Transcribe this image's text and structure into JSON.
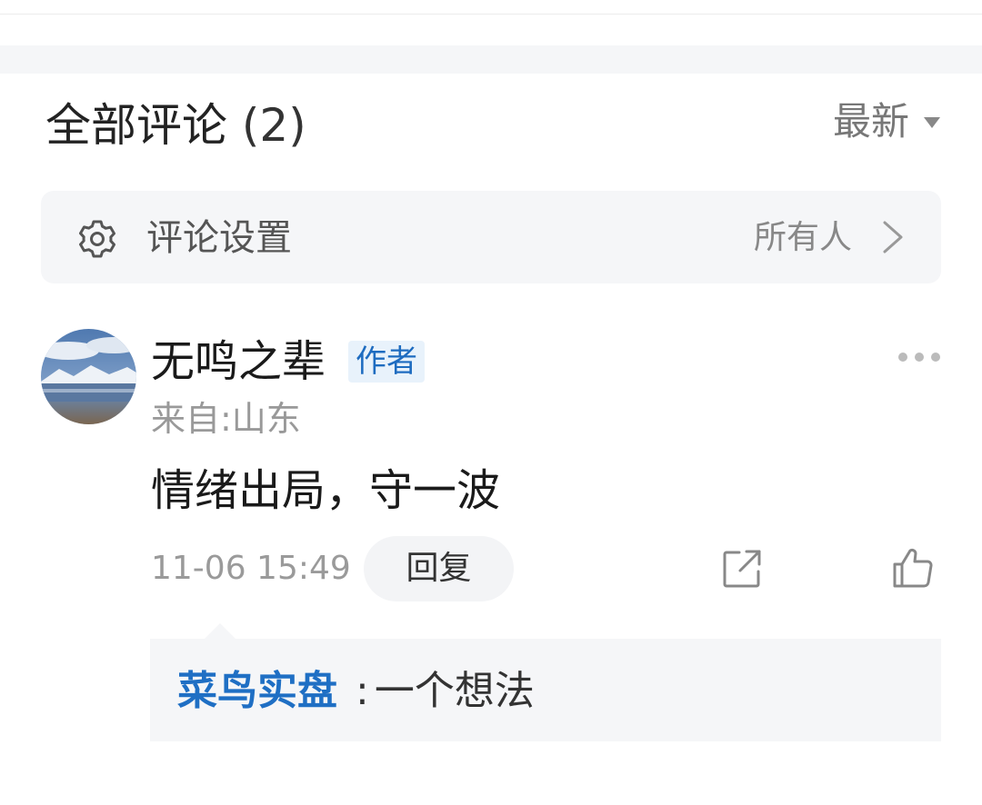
{
  "header": {
    "title": "全部评论",
    "count": "(2)",
    "sort_label": "最新"
  },
  "settings": {
    "label": "评论设置",
    "value": "所有人"
  },
  "comment": {
    "username": "无鸣之辈",
    "badge": "作者",
    "location": "来自:山东",
    "text": "情绪出局，守一波",
    "timestamp": "11-06 15:49",
    "reply_button": "回复"
  },
  "reply": {
    "user": "菜鸟实盘",
    "separator": ":",
    "text": "一个想法"
  },
  "icons": {
    "settings": "gear-icon",
    "settings_arrow": "chevron-right-icon",
    "sort": "caret-down-icon",
    "more": "more-dots-icon",
    "share": "share-icon",
    "like": "thumbs-up-icon"
  },
  "colors": {
    "accent": "#1f6fc4",
    "badge_bg": "#e8f2fb",
    "panel_bg": "#f5f6f8"
  }
}
